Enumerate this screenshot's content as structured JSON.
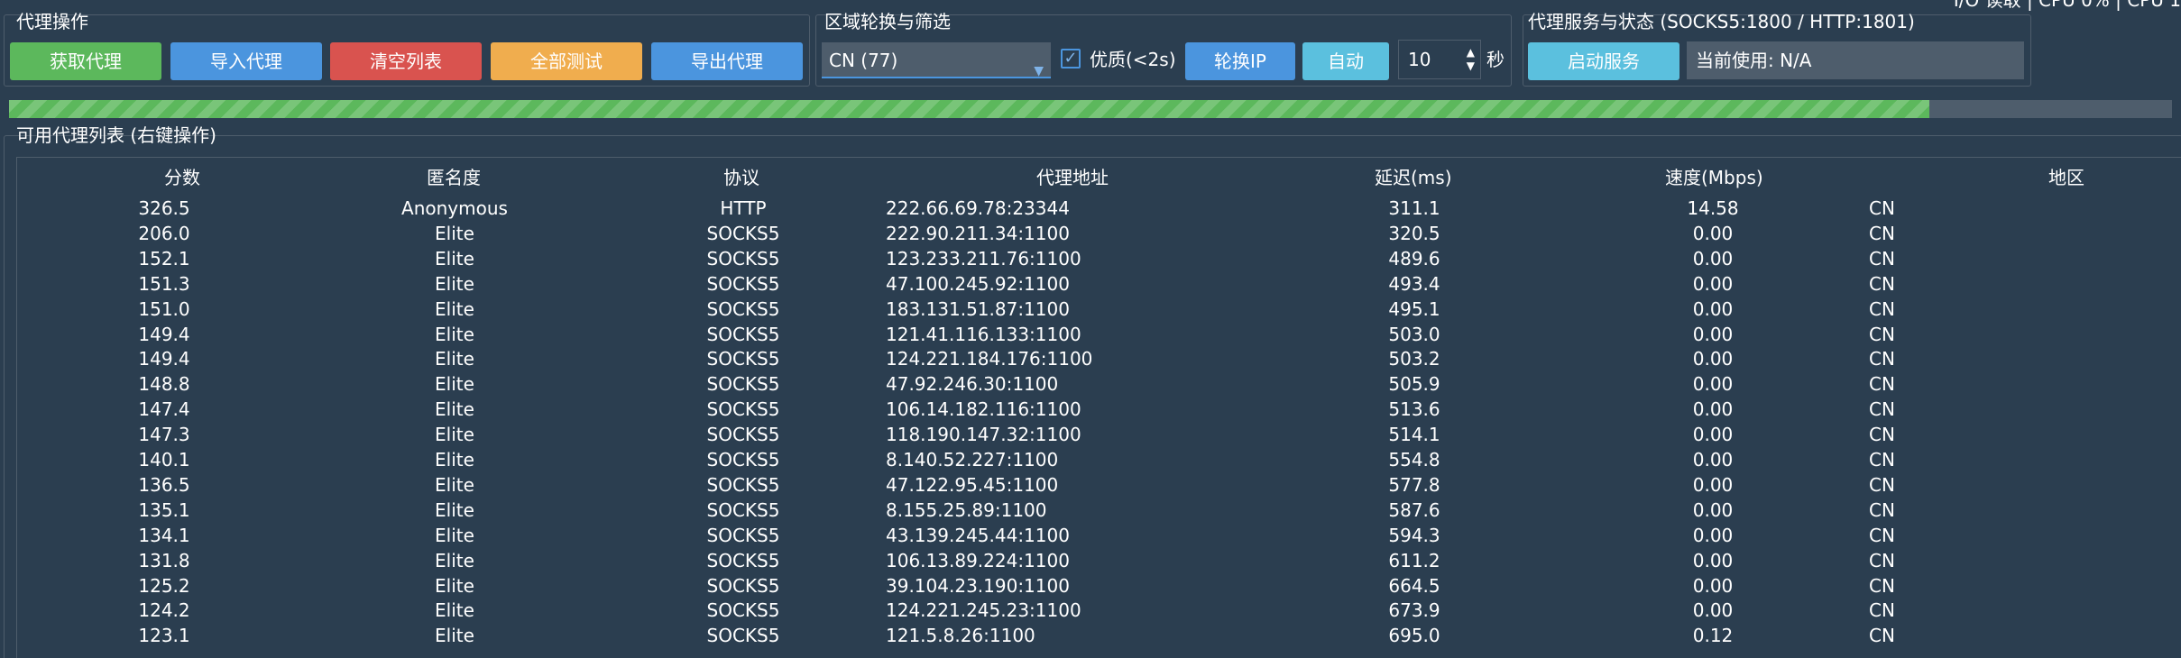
{
  "top_partial": "I/O 读取  |  CPU 0%  |  CPU 1",
  "proxy_ops": {
    "title": "代理操作",
    "buttons": [
      "获取代理",
      "导入代理",
      "清空列表",
      "全部测试",
      "导出代理"
    ]
  },
  "region": {
    "title": "区域轮换与筛选",
    "select_value": "CN (77)",
    "quality_label": "优质(<2s)",
    "quality_checked": true,
    "rotate_button": "轮换IP",
    "auto_button": "自动",
    "interval_value": "10",
    "interval_unit": "秒"
  },
  "service": {
    "title": "代理服务与状态 (SOCKS5:1800 / HTTP:1801)",
    "start_button": "启动服务",
    "current_status": "当前使用: N/A"
  },
  "progress": {
    "value": 0.888
  },
  "table": {
    "title": "可用代理列表 (右键操作)",
    "columns": [
      "分数",
      "匿名度",
      "协议",
      "代理地址",
      "延迟(ms)",
      "速度(Mbps)",
      "地区"
    ],
    "rows": [
      [
        "326.5",
        "Anonymous",
        "HTTP",
        "222.66.69.78:23344",
        "311.1",
        "14.58",
        "CN"
      ],
      [
        "206.0",
        "Elite",
        "SOCKS5",
        "222.90.211.34:1100",
        "320.5",
        "0.00",
        "CN"
      ],
      [
        "152.1",
        "Elite",
        "SOCKS5",
        "123.233.211.76:1100",
        "489.6",
        "0.00",
        "CN"
      ],
      [
        "151.3",
        "Elite",
        "SOCKS5",
        "47.100.245.92:1100",
        "493.4",
        "0.00",
        "CN"
      ],
      [
        "151.0",
        "Elite",
        "SOCKS5",
        "183.131.51.87:1100",
        "495.1",
        "0.00",
        "CN"
      ],
      [
        "149.4",
        "Elite",
        "SOCKS5",
        "121.41.116.133:1100",
        "503.0",
        "0.00",
        "CN"
      ],
      [
        "149.4",
        "Elite",
        "SOCKS5",
        "124.221.184.176:1100",
        "503.2",
        "0.00",
        "CN"
      ],
      [
        "148.8",
        "Elite",
        "SOCKS5",
        "47.92.246.30:1100",
        "505.9",
        "0.00",
        "CN"
      ],
      [
        "147.4",
        "Elite",
        "SOCKS5",
        "106.14.182.116:1100",
        "513.6",
        "0.00",
        "CN"
      ],
      [
        "147.3",
        "Elite",
        "SOCKS5",
        "118.190.147.32:1100",
        "514.1",
        "0.00",
        "CN"
      ],
      [
        "140.1",
        "Elite",
        "SOCKS5",
        "8.140.52.227:1100",
        "554.8",
        "0.00",
        "CN"
      ],
      [
        "136.5",
        "Elite",
        "SOCKS5",
        "47.122.95.45:1100",
        "577.8",
        "0.00",
        "CN"
      ],
      [
        "135.1",
        "Elite",
        "SOCKS5",
        "8.155.25.89:1100",
        "587.6",
        "0.00",
        "CN"
      ],
      [
        "134.1",
        "Elite",
        "SOCKS5",
        "43.139.245.44:1100",
        "594.3",
        "0.00",
        "CN"
      ],
      [
        "131.8",
        "Elite",
        "SOCKS5",
        "106.13.89.224:1100",
        "611.2",
        "0.00",
        "CN"
      ],
      [
        "125.2",
        "Elite",
        "SOCKS5",
        "39.104.23.190:1100",
        "664.5",
        "0.00",
        "CN"
      ],
      [
        "124.2",
        "Elite",
        "SOCKS5",
        "124.221.245.23:1100",
        "673.9",
        "0.00",
        "CN"
      ],
      [
        "123.1",
        "Elite",
        "SOCKS5",
        "121.5.8.26:1100",
        "695.0",
        "0.12",
        "CN"
      ]
    ]
  },
  "colors": {
    "background": "#2b3e50",
    "success": "#5cb85c",
    "primary": "#4b95de",
    "danger": "#d9534f",
    "warning": "#f0ad4e",
    "info": "#5bc0de",
    "field": "#4e5d6c"
  }
}
